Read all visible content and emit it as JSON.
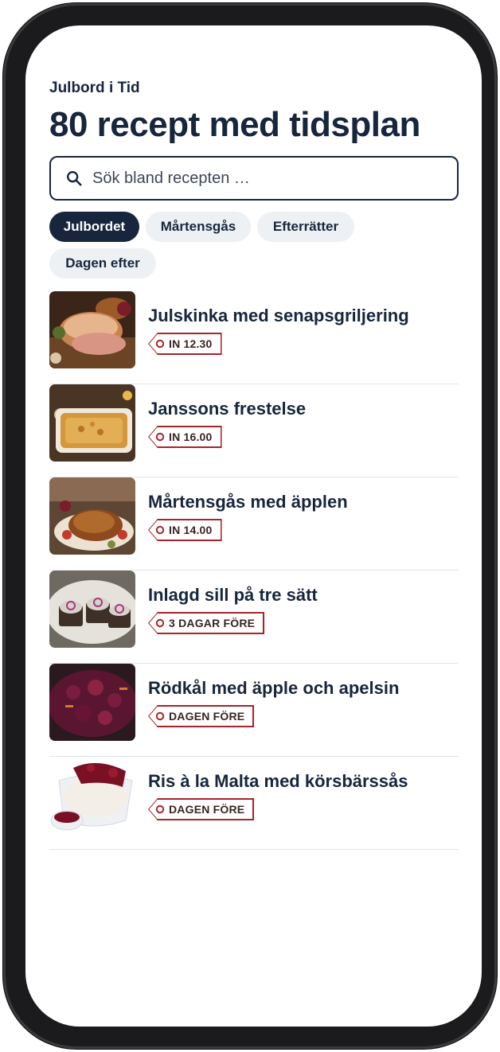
{
  "app": {
    "name": "Julbord i Tid"
  },
  "header": {
    "title": "80 recept med tidsplan"
  },
  "search": {
    "placeholder": "Sök bland recepten …",
    "icon": "search-icon"
  },
  "categories": [
    {
      "label": "Julbordet",
      "active": true
    },
    {
      "label": "Mårtensgås",
      "active": false
    },
    {
      "label": "Efterrätter",
      "active": false
    },
    {
      "label": "Dagen efter",
      "active": false
    }
  ],
  "recipes": [
    {
      "title": "Julskinka med senapsgriljering",
      "timing": "IN 12.30"
    },
    {
      "title": "Janssons frestelse",
      "timing": "IN 16.00"
    },
    {
      "title": "Mårtensgås med äpplen",
      "timing": "IN 14.00"
    },
    {
      "title": "Inlagd sill på tre sätt",
      "timing": "3 DAGAR FÖRE"
    },
    {
      "title": "Rödkål med äpple och apelsin",
      "timing": "DAGEN FÖRE"
    },
    {
      "title": "Ris à la Malta med körsbärssås",
      "timing": "DAGEN FÖRE"
    }
  ],
  "colors": {
    "navy": "#17263d",
    "tag_red": "#a8232b",
    "chip_bg": "#eef1f4"
  }
}
